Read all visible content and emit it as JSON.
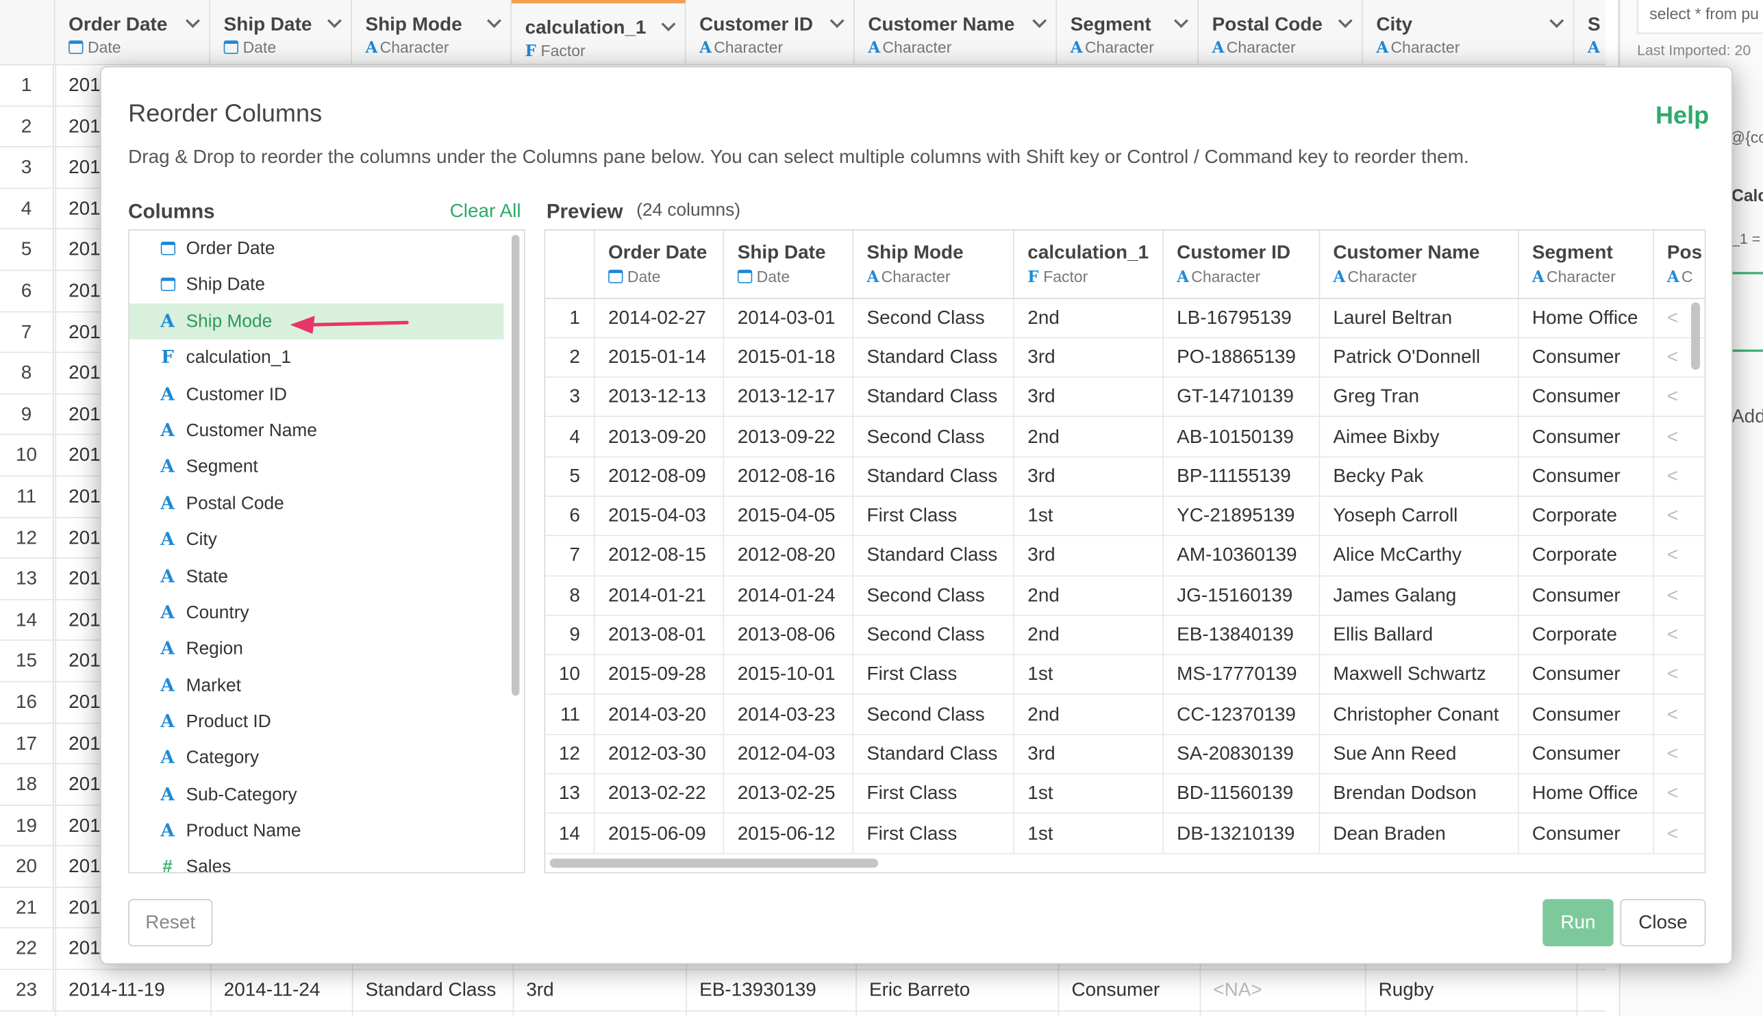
{
  "background": {
    "columns": [
      {
        "name": "Order Date",
        "type": "Date",
        "kind": "date"
      },
      {
        "name": "Ship Date",
        "type": "Date",
        "kind": "date"
      },
      {
        "name": "Ship Mode",
        "type": "Character",
        "kind": "char"
      },
      {
        "name": "calculation_1",
        "type": "Factor",
        "kind": "factor"
      },
      {
        "name": "Customer ID",
        "type": "Character",
        "kind": "char"
      },
      {
        "name": "Customer Name",
        "type": "Character",
        "kind": "char"
      },
      {
        "name": "Segment",
        "type": "Character",
        "kind": "char"
      },
      {
        "name": "Postal Code",
        "type": "Character",
        "kind": "char"
      },
      {
        "name": "City",
        "type": "Character",
        "kind": "char"
      },
      {
        "name": "S",
        "type": "",
        "kind": "char"
      }
    ],
    "row_numbers": [
      "1",
      "2",
      "3",
      "4",
      "5",
      "6",
      "7",
      "8",
      "9",
      "10",
      "11",
      "12",
      "13",
      "14",
      "15",
      "16",
      "17",
      "18",
      "19",
      "20",
      "21",
      "22"
    ],
    "row_prefix": "201",
    "last_row": {
      "num": "23",
      "order_date": "2014-11-19",
      "ship_date": "2014-11-24",
      "ship_mode": "Standard Class",
      "calc": "3rd",
      "customer_id": "EB-13930139",
      "customer_name": "Eric Barreto",
      "segment": "Consumer",
      "postal": "<NA>",
      "city": "Rugby"
    },
    "right_panel": {
      "query": "select * from pu",
      "imported": "Last Imported: 20",
      "vars": "@{co",
      "calc": "Calc",
      "eq": "_1 =",
      "add": "Add"
    }
  },
  "modal": {
    "title": "Reorder Columns",
    "help": "Help",
    "description": "Drag & Drop to reorder the columns under the Columns pane below. You can select multiple columns with Shift key or Control / Command key to reorder them.",
    "columns_header": "Columns",
    "clear_all": "Clear All",
    "preview_header": "Preview",
    "preview_count": "(24 columns)",
    "reset": "Reset",
    "run": "Run",
    "close": "Close"
  },
  "column_list": [
    {
      "label": "Order Date",
      "kind": "date"
    },
    {
      "label": "Ship Date",
      "kind": "date"
    },
    {
      "label": "Ship Mode",
      "kind": "char",
      "selected": true
    },
    {
      "label": "calculation_1",
      "kind": "factor"
    },
    {
      "label": "Customer ID",
      "kind": "char"
    },
    {
      "label": "Customer Name",
      "kind": "char"
    },
    {
      "label": "Segment",
      "kind": "char"
    },
    {
      "label": "Postal Code",
      "kind": "char"
    },
    {
      "label": "City",
      "kind": "char"
    },
    {
      "label": "State",
      "kind": "char"
    },
    {
      "label": "Country",
      "kind": "char"
    },
    {
      "label": "Region",
      "kind": "char"
    },
    {
      "label": "Market",
      "kind": "char"
    },
    {
      "label": "Product ID",
      "kind": "char"
    },
    {
      "label": "Category",
      "kind": "char"
    },
    {
      "label": "Sub-Category",
      "kind": "char"
    },
    {
      "label": "Product Name",
      "kind": "char"
    },
    {
      "label": "Sales",
      "kind": "num"
    }
  ],
  "preview": {
    "columns": [
      {
        "name": "Order Date",
        "type": "Date",
        "kind": "date"
      },
      {
        "name": "Ship Date",
        "type": "Date",
        "kind": "date"
      },
      {
        "name": "Ship Mode",
        "type": "Character",
        "kind": "char"
      },
      {
        "name": "calculation_1",
        "type": "Factor",
        "kind": "factor"
      },
      {
        "name": "Customer ID",
        "type": "Character",
        "kind": "char"
      },
      {
        "name": "Customer Name",
        "type": "Character",
        "kind": "char"
      },
      {
        "name": "Segment",
        "type": "Character",
        "kind": "char"
      },
      {
        "name": "Pos",
        "type": "C",
        "kind": "char"
      }
    ],
    "rows": [
      [
        "1",
        "2014-02-27",
        "2014-03-01",
        "Second Class",
        "2nd",
        "LB-16795139",
        "Laurel Beltran",
        "Home Office",
        "<"
      ],
      [
        "2",
        "2015-01-14",
        "2015-01-18",
        "Standard Class",
        "3rd",
        "PO-18865139",
        "Patrick O'Donnell",
        "Consumer",
        "<"
      ],
      [
        "3",
        "2013-12-13",
        "2013-12-17",
        "Standard Class",
        "3rd",
        "GT-14710139",
        "Greg Tran",
        "Consumer",
        "<"
      ],
      [
        "4",
        "2013-09-20",
        "2013-09-22",
        "Second Class",
        "2nd",
        "AB-10150139",
        "Aimee Bixby",
        "Consumer",
        "<"
      ],
      [
        "5",
        "2012-08-09",
        "2012-08-16",
        "Standard Class",
        "3rd",
        "BP-11155139",
        "Becky Pak",
        "Consumer",
        "<"
      ],
      [
        "6",
        "2015-04-03",
        "2015-04-05",
        "First Class",
        "1st",
        "YC-21895139",
        "Yoseph Carroll",
        "Corporate",
        "<"
      ],
      [
        "7",
        "2012-08-15",
        "2012-08-20",
        "Standard Class",
        "3rd",
        "AM-10360139",
        "Alice McCarthy",
        "Corporate",
        "<"
      ],
      [
        "8",
        "2014-01-21",
        "2014-01-24",
        "Second Class",
        "2nd",
        "JG-15160139",
        "James Galang",
        "Consumer",
        "<"
      ],
      [
        "9",
        "2013-08-01",
        "2013-08-06",
        "Second Class",
        "2nd",
        "EB-13840139",
        "Ellis Ballard",
        "Corporate",
        "<"
      ],
      [
        "10",
        "2015-09-28",
        "2015-10-01",
        "First Class",
        "1st",
        "MS-17770139",
        "Maxwell Schwartz",
        "Consumer",
        "<"
      ],
      [
        "11",
        "2014-03-20",
        "2014-03-23",
        "Second Class",
        "2nd",
        "CC-12370139",
        "Christopher Conant",
        "Consumer",
        "<"
      ],
      [
        "12",
        "2012-03-30",
        "2012-04-03",
        "Standard Class",
        "3rd",
        "SA-20830139",
        "Sue Ann Reed",
        "Consumer",
        "<"
      ],
      [
        "13",
        "2013-02-22",
        "2013-02-25",
        "First Class",
        "1st",
        "BD-11560139",
        "Brendan Dodson",
        "Home Office",
        "<"
      ],
      [
        "14",
        "2015-06-09",
        "2015-06-12",
        "First Class",
        "1st",
        "DB-13210139",
        "Dean Braden",
        "Consumer",
        "<"
      ]
    ]
  },
  "colors": {
    "accent": "#2eaa6a",
    "type_icon": "#1e8ad6",
    "selected_bg": "#d8f0dc",
    "arrow": "#e8336b",
    "run_button": "#7dc99c"
  }
}
